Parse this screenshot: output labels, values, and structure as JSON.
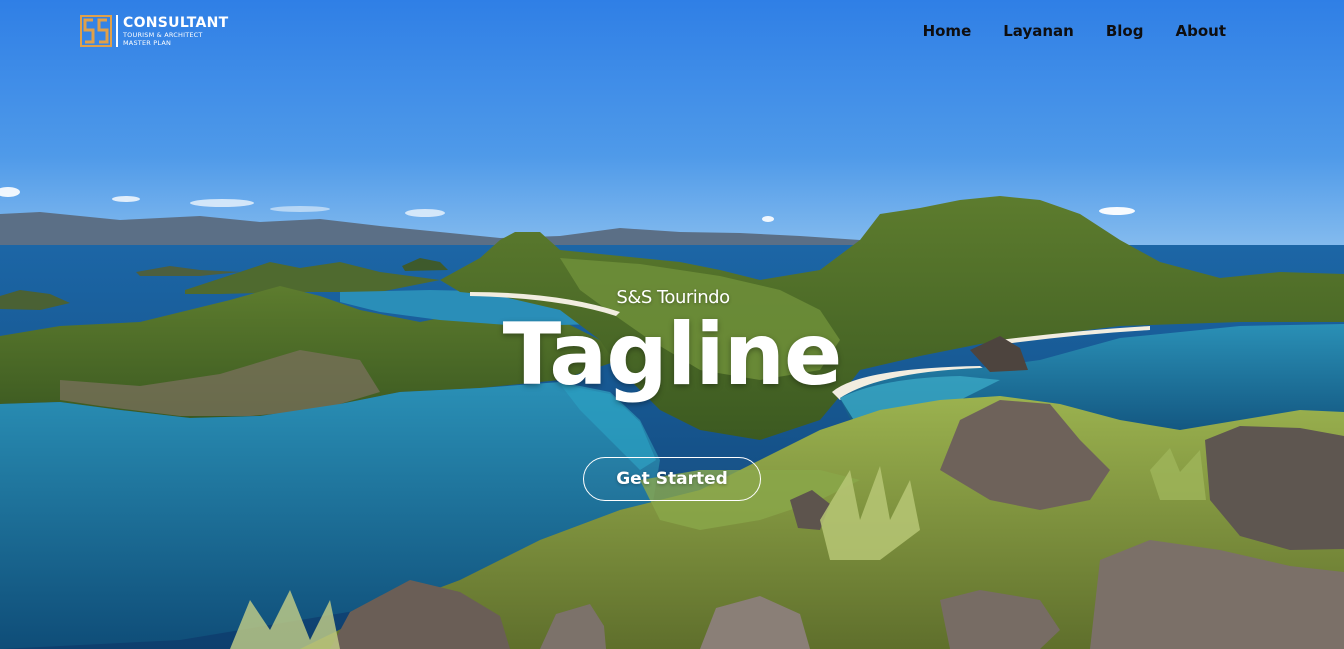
{
  "header": {
    "logo_title": "CONSULTANT",
    "logo_sub_1": "TOURISM & ARCHITECT",
    "logo_sub_2": "MASTER PLAN",
    "logo_mark": "SS"
  },
  "nav": {
    "items": [
      "Home",
      "Layanan",
      "Blog",
      "About"
    ]
  },
  "hero": {
    "brand": "S&S Tourindo",
    "tagline": "Tagline",
    "cta_label": "Get Started"
  },
  "colors": {
    "logo_accent": "#e0a04a",
    "nav_text": "#0e0e10",
    "sky": "#3f8ee6",
    "sea": "#1a6a96",
    "hills": "#6f8f3a"
  }
}
